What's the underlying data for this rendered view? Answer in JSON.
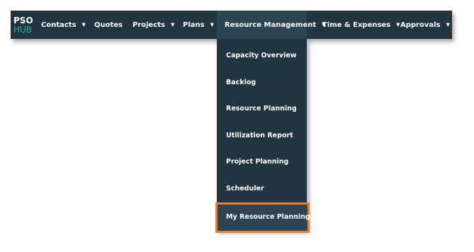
{
  "logo": {
    "line1": "PSO",
    "line2": "HUB"
  },
  "nav": {
    "contacts": "Contacts",
    "quotes": "Quotes",
    "projects": "Projects",
    "plans": "Plans",
    "resource_management": "Resource Management",
    "time_expenses": "Time & Expenses",
    "approvals": "Approvals",
    "caret": "▼"
  },
  "dropdown": {
    "items": [
      "Capacity Overview",
      "Backlog",
      "Resource Planning",
      "Utilization Report",
      "Project Planning",
      "Scheduler",
      "My Resource Planning"
    ]
  },
  "colors": {
    "nav_bg": "#21343f",
    "active_bg": "#2d4552",
    "logo_accent": "#2bb3a6",
    "highlight": "#e0833a"
  }
}
